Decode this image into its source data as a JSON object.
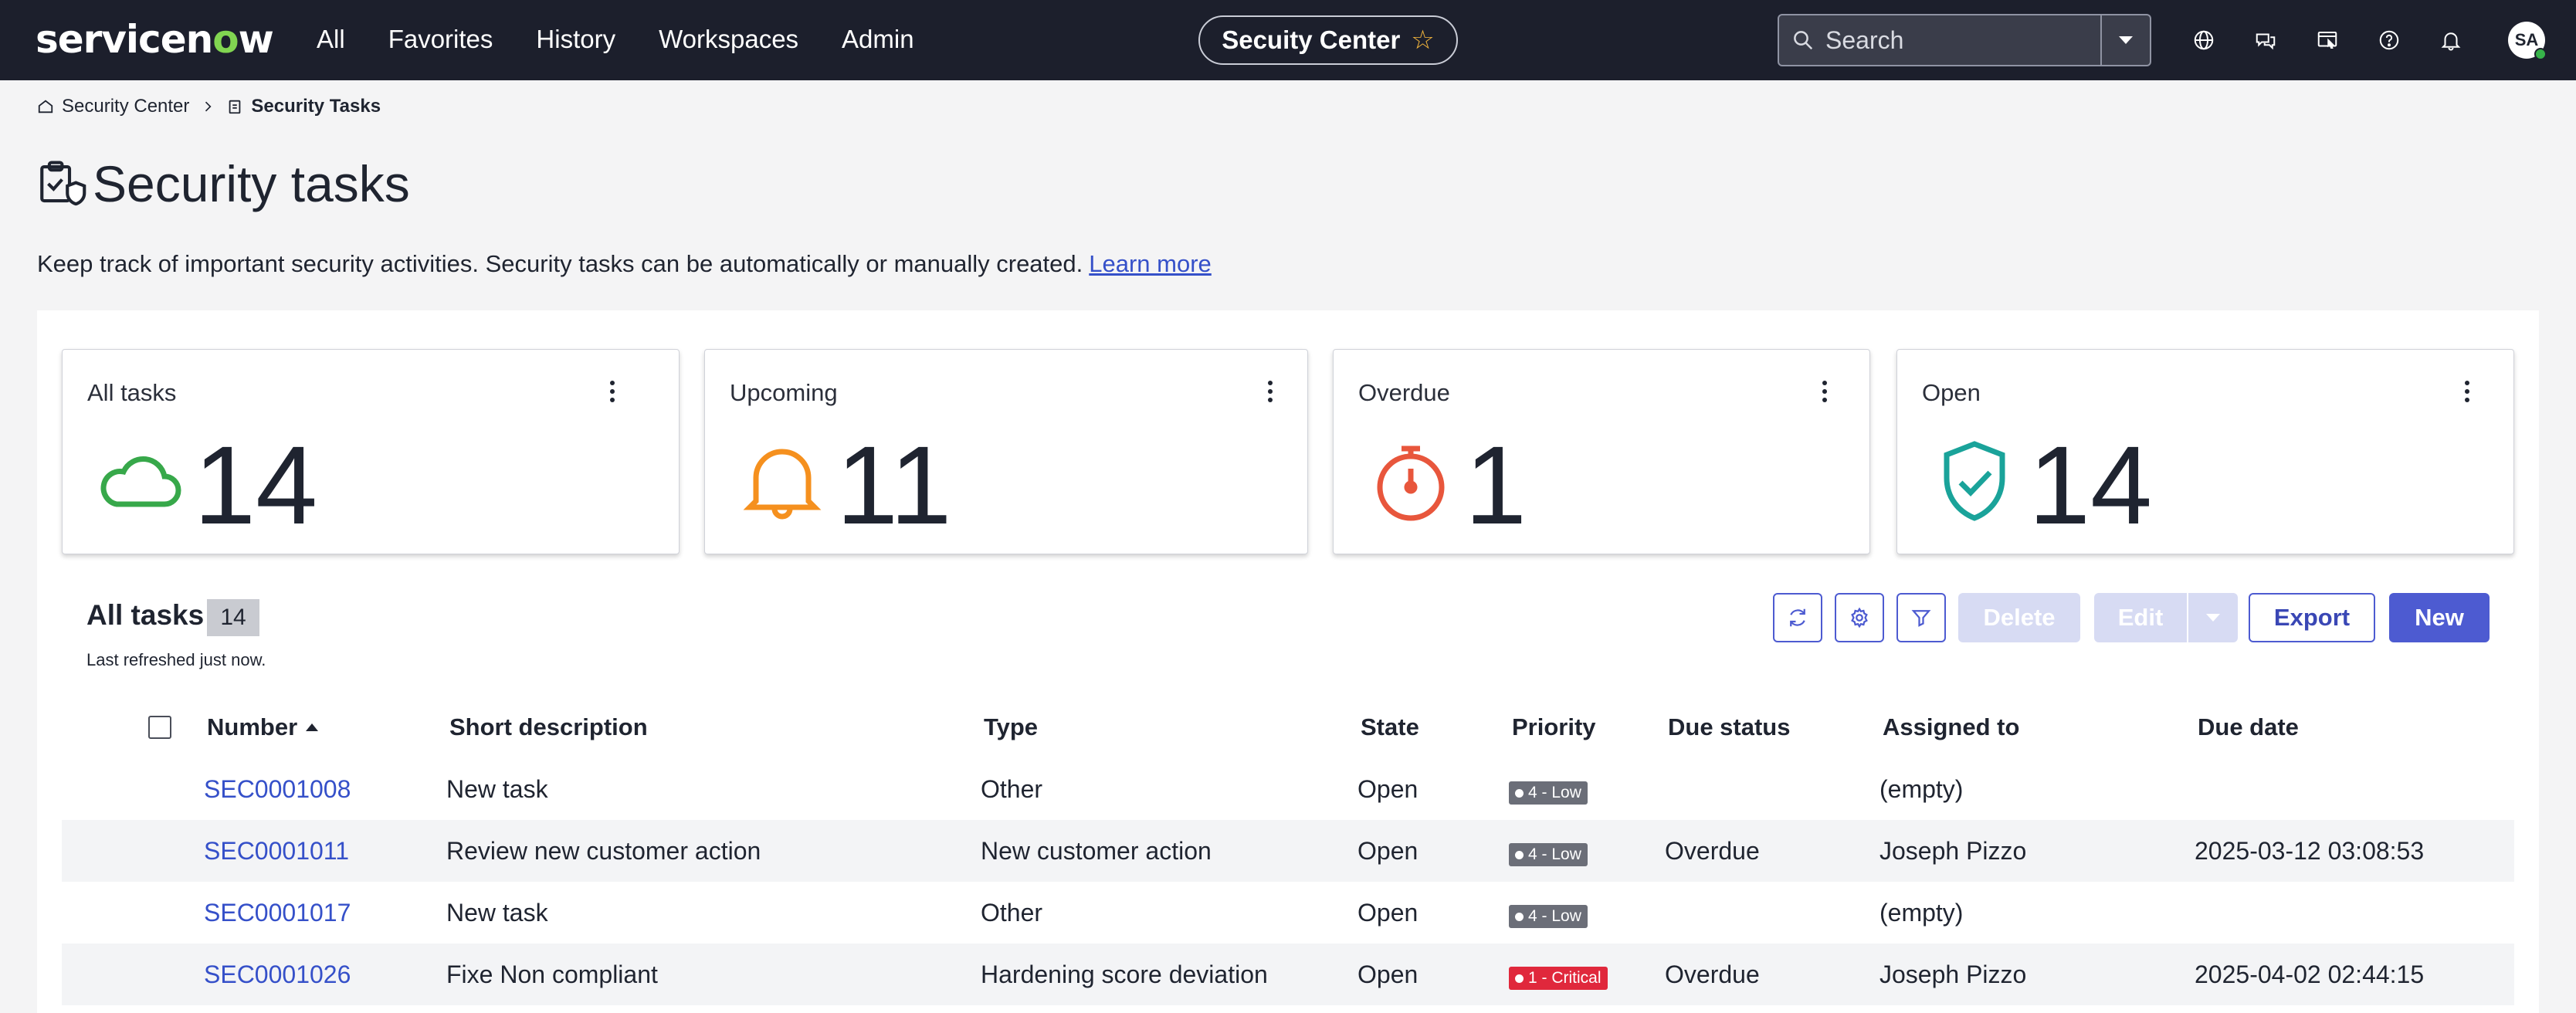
{
  "app": {
    "logo_text": "servicenow"
  },
  "nav": {
    "links": [
      "All",
      "Favorites",
      "History",
      "Workspaces",
      "Admin"
    ],
    "context": "Secuity Center",
    "search_placeholder": "Search",
    "user_initials": "SA"
  },
  "breadcrumb": {
    "root": "Security Center",
    "current": "Security Tasks"
  },
  "page": {
    "title": "Security tasks",
    "description": "Keep track of important security activities. Security tasks can be automatically or manually created.",
    "learn_more": "Learn more"
  },
  "cards": [
    {
      "label": "All tasks",
      "value": "14",
      "icon": "cloud-icon",
      "color": "#37a84a"
    },
    {
      "label": "Upcoming",
      "value": "11",
      "icon": "bell-icon",
      "color": "#f5901e"
    },
    {
      "label": "Overdue",
      "value": "1",
      "icon": "stopwatch-icon",
      "color": "#e8563c"
    },
    {
      "label": "Open",
      "value": "14",
      "icon": "shield-check-icon",
      "color": "#1aa39a"
    }
  ],
  "list": {
    "title": "All tasks",
    "count": "14",
    "refreshed": "Last refreshed just now.",
    "buttons": {
      "delete": "Delete",
      "edit": "Edit",
      "export": "Export",
      "new": "New"
    }
  },
  "table": {
    "columns": [
      "Number",
      "Short description",
      "Type",
      "State",
      "Priority",
      "Due status",
      "Assigned to",
      "Due date"
    ],
    "rows": [
      {
        "number": "SEC0001008",
        "short_description": "New task",
        "type": "Other",
        "state": "Open",
        "priority": "4 - Low",
        "due_status": "",
        "assigned_to": "(empty)",
        "due_date": ""
      },
      {
        "number": "SEC0001011",
        "short_description": "Review new customer action",
        "type": "New customer action",
        "state": "Open",
        "priority": "4 - Low",
        "due_status": "Overdue",
        "assigned_to": "Joseph Pizzo",
        "due_date": "2025-03-12 03:08:53"
      },
      {
        "number": "SEC0001017",
        "short_description": "New task",
        "type": "Other",
        "state": "Open",
        "priority": "4 - Low",
        "due_status": "",
        "assigned_to": "(empty)",
        "due_date": ""
      },
      {
        "number": "SEC0001026",
        "short_description": "Fixe Non compliant",
        "type": "Hardening score deviation",
        "state": "Open",
        "priority": "1 - Critical",
        "due_status": "Overdue",
        "assigned_to": "Joseph Pizzo",
        "due_date": "2025-04-02 02:44:15"
      }
    ]
  },
  "colors": {
    "low_priority": "#6b6e78",
    "critical_priority": "#e0283c",
    "accent": "#4d5bd1",
    "link": "#3550c9"
  }
}
